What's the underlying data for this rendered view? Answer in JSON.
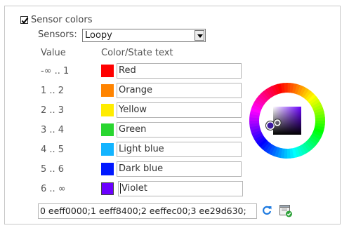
{
  "title": "Sensor colors",
  "enabled": true,
  "sensors": {
    "label": "Sensors:",
    "selected": "Loopy"
  },
  "headers": {
    "value": "Value",
    "color": "Color/State text"
  },
  "rows": [
    {
      "range": "-∞ .. 1",
      "color": "#ff0000",
      "text": "Red"
    },
    {
      "range": "1 .. 2",
      "color": "#ff8400",
      "text": "Orange"
    },
    {
      "range": "2 .. 3",
      "color": "#ffec00",
      "text": "Yellow"
    },
    {
      "range": "3 .. 4",
      "color": "#29d630",
      "text": "Green"
    },
    {
      "range": "4 .. 5",
      "color": "#13b4ff",
      "text": "Light blue"
    },
    {
      "range": "5 .. 6",
      "color": "#0018ff",
      "text": "Dark blue"
    },
    {
      "range": "6 .. ∞",
      "color": "#6b00ff",
      "text": "Violet"
    }
  ],
  "color_string": "0 eeff0000;1 eeff8400;2 eeffec00;3 ee29d630;",
  "icons": {
    "refresh": "refresh-icon",
    "save": "save-icon",
    "picker": "color-wheel-picker"
  },
  "picker_color": "#6b00ff"
}
